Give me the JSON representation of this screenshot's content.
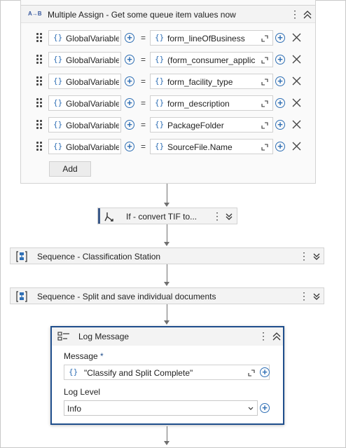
{
  "assign": {
    "icon": "A→B",
    "title": "Multiple Assign - Get some queue item values now",
    "add_label": "Add",
    "rows": [
      {
        "left": "GlobalVariables",
        "right": "form_lineOfBusiness"
      },
      {
        "left": "GlobalVariables",
        "right": "(form_consumer_applic"
      },
      {
        "left": "GlobalVariables",
        "right": "form_facility_type"
      },
      {
        "left": "GlobalVariables",
        "right": "form_description"
      },
      {
        "left": "GlobalVariables",
        "right": "PackageFolder"
      },
      {
        "left": "GlobalVariables",
        "right": "SourceFile.Name"
      }
    ],
    "equals": "="
  },
  "if_activity": {
    "title": "If - convert TIF to..."
  },
  "sequence1": {
    "title": "Sequence - Classification Station"
  },
  "sequence2": {
    "title": "Sequence - Split and save individual documents"
  },
  "log_message": {
    "title": "Log Message",
    "message_label": "Message",
    "required_mark": "*",
    "message_value": "\"Classify and Split Complete\"",
    "level_label": "Log Level",
    "level_value": "Info"
  },
  "icons": {
    "braces": "{}",
    "kebab": "⋮"
  },
  "colors": {
    "accent": "#1f4e8c",
    "variable_blue": "#2f6fb5",
    "card_bg": "#f3f3f3"
  }
}
